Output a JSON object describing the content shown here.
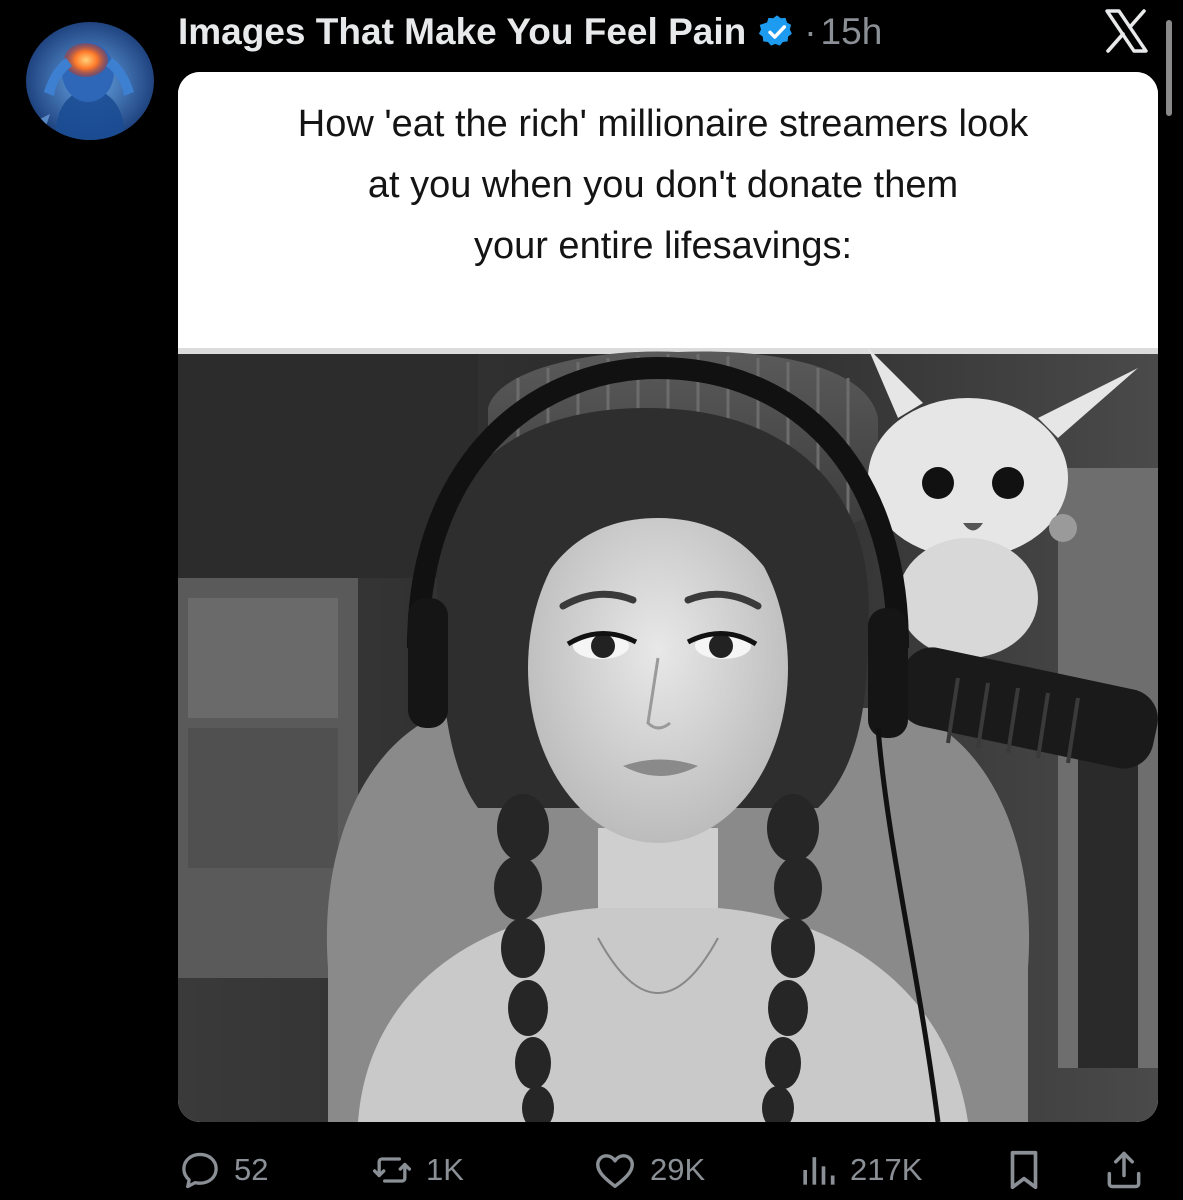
{
  "post": {
    "display_name": "Images That Make You Feel Pain",
    "separator": "·",
    "time": "15h",
    "verified_icon": "verified-badge-icon",
    "avatar_alt": "profile picture: person holding head in pain with glowing brain"
  },
  "platform": {
    "logo_icon": "x-logo-icon"
  },
  "media": {
    "caption_lines": [
      "How 'eat the rich' millionaire streamers look",
      "at you when you don't donate them",
      "your entire lifesavings:"
    ],
    "photo_alt": "black and white photo of a streamer with headphones and braids looking at the camera"
  },
  "actions": {
    "reply": {
      "icon": "reply-bubble-icon",
      "count": "52"
    },
    "repost": {
      "icon": "repost-arrows-icon",
      "count": "1K"
    },
    "like": {
      "icon": "heart-icon",
      "count": "29K"
    },
    "views": {
      "icon": "views-bars-icon",
      "count": "217K"
    },
    "bookmark": {
      "icon": "bookmark-icon"
    },
    "share": {
      "icon": "share-upload-icon"
    }
  },
  "colors": {
    "background": "#000000",
    "name": "#e7e9ea",
    "meta": "#8b9096",
    "verified": "#1d9bf0"
  }
}
